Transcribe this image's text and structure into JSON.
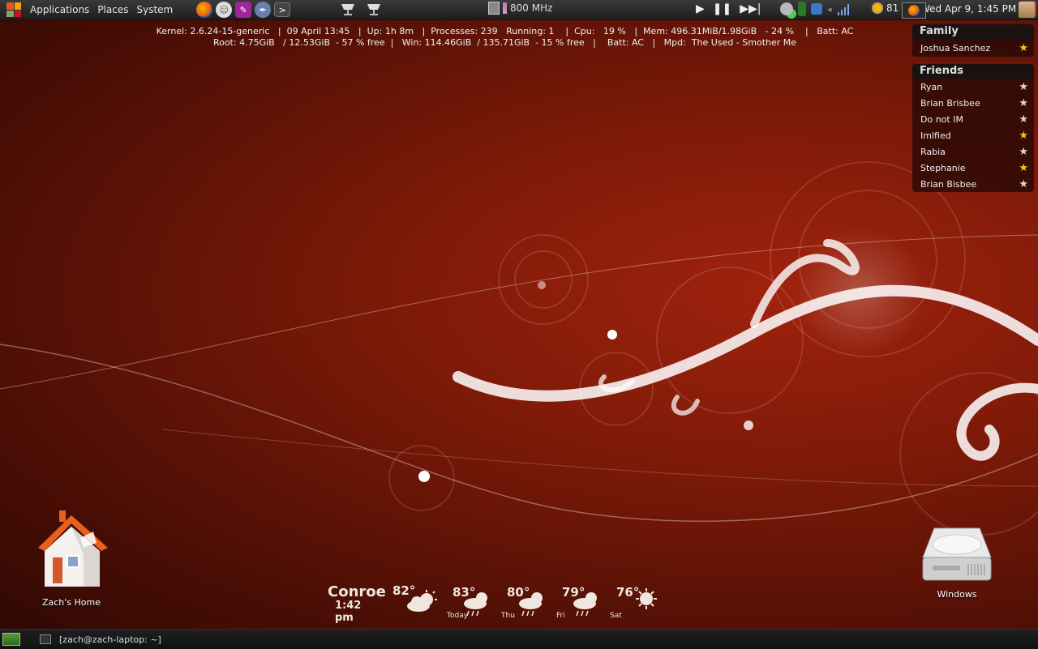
{
  "top_panel": {
    "menus": [
      "Applications",
      "Places",
      "System"
    ],
    "cpu_freq": "800 MHz",
    "weather_temp": "81 °F",
    "clock": "Wed Apr  9,  1:45 PM"
  },
  "conky": {
    "line1": "Kernel: 2.6.24-15-generic   |  09 April 13:45   |  Up: 1h 8m   |  Processes: 239   Running: 1    |  Cpu:   19 %   |  Mem: 496.31MiB/1.98GiB   - 24 %    |   Batt: AC",
    "line2": "Root: 4.75GiB   / 12.53GiB  - 57 % free  |   Win: 114.46GiB  / 135.71GiB  - 15 % free   |    Batt: AC   |   Mpd:  The Used - Smother Me"
  },
  "buddy_list": {
    "groups": [
      {
        "name": "Family",
        "buddies": [
          {
            "name": "Joshua Sanchez",
            "star": "gold"
          }
        ]
      },
      {
        "name": "Friends",
        "buddies": [
          {
            "name": "Ryan",
            "star": "gray"
          },
          {
            "name": "Brian Brisbee",
            "star": "gray"
          },
          {
            "name": "Do not IM",
            "star": "gray"
          },
          {
            "name": "Imlfied",
            "star": "gold"
          },
          {
            "name": "Rabia",
            "star": "gray"
          },
          {
            "name": "Stephanie",
            "star": "gold"
          },
          {
            "name": "Brian Bisbee",
            "star": "gray"
          }
        ]
      }
    ]
  },
  "desktop": {
    "home_label": "Zach's Home",
    "windows_label": "Windows"
  },
  "weather": {
    "city": "Conroe",
    "time": "1:42 pm",
    "current_temp": "82°",
    "forecast": [
      {
        "temp": "83°",
        "day": "Today",
        "icon": "thunderstorm-icon"
      },
      {
        "temp": "80°",
        "day": "Thu",
        "icon": "thunderstorm-icon"
      },
      {
        "temp": "79°",
        "day": "Fri",
        "icon": "thunderstorm-icon"
      },
      {
        "temp": "76°",
        "day": "Sat",
        "icon": "sunny-icon"
      }
    ]
  },
  "bottom_panel": {
    "task_label": "[zach@zach-laptop: ~]"
  }
}
